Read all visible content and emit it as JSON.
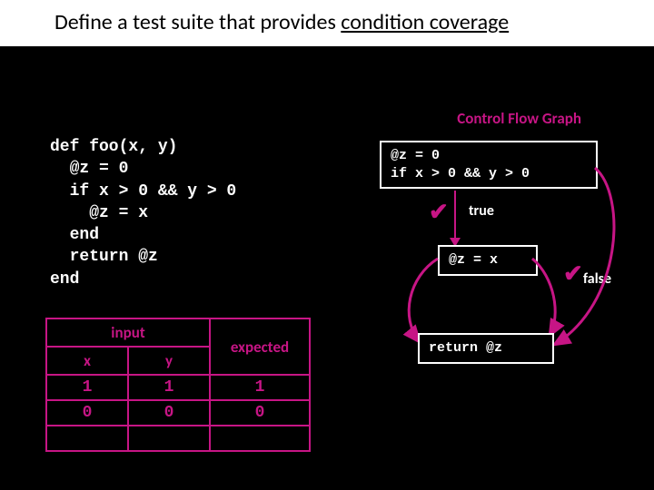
{
  "title_prefix": "Define a test suite that provides ",
  "title_underlined": "condition coverage",
  "cfg_heading": "Control Flow Graph",
  "code": "def foo(x, y)\n  @z = 0\n  if x > 0 && y > 0\n    @z = x\n  end\n  return @z\nend",
  "node1": "@z = 0\nif x > 0 && y > 0",
  "node2": "@z = x",
  "node3": "return @z",
  "true_label": "true",
  "false_label": "false",
  "checkmark": "✔",
  "table": {
    "input_header": "input",
    "x_header": "x",
    "y_header": "y",
    "expected_header": "expected",
    "rows": [
      {
        "x": "1",
        "y": "1",
        "expected": "1"
      },
      {
        "x": "0",
        "y": "0",
        "expected": "0"
      },
      {
        "x": "",
        "y": "",
        "expected": ""
      }
    ]
  }
}
